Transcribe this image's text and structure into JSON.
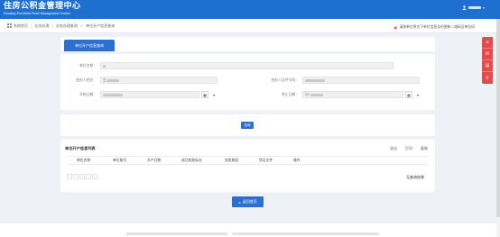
{
  "header": {
    "title_cn": "住房公积金管理中心",
    "title_en": "Housing Provident Fund Management Center",
    "user_caret": "▾"
  },
  "breadcrumb": {
    "items": [
      "系统首页",
      "|",
      "业务处理",
      "|",
      "业务办理查询",
      ">",
      "单位开户信息查询"
    ],
    "notice": "请贵单位将名下单位信息及时更新二维码及单位码"
  },
  "tab": {
    "label": "单位开户信息查询"
  },
  "form": {
    "unit_name_label": "单位名称：",
    "handler_name_label": "经办人姓名：",
    "handler_name_value": "王",
    "handler_id_label": "经办人证件号码：",
    "start_date_label": "开始日期：",
    "end_date_label": "终止日期：",
    "end_date_value": "20",
    "calendar_glyph": "▦",
    "dropdown_glyph": "▾"
  },
  "search": {
    "label": "查询"
  },
  "results": {
    "title": "单位开户信息列表",
    "tools": [
      "导出",
      "打印",
      "复制"
    ],
    "columns": [
      "单位名称",
      "单位账号",
      "开户日期",
      "成功失败标志",
      "失败原因",
      "凭证文件",
      "操作"
    ],
    "pager": [
      "«",
      "‹",
      "1",
      "›",
      "»"
    ],
    "empty_text": "无查询结果"
  },
  "back_button": {
    "label": "返回首页"
  },
  "side_tools": [
    "⌂",
    "✉",
    "▤",
    "⚲"
  ],
  "colors": {
    "primary": "#2b6fd0",
    "topbar": "#1f6fd1",
    "side": "#e44c4c"
  }
}
